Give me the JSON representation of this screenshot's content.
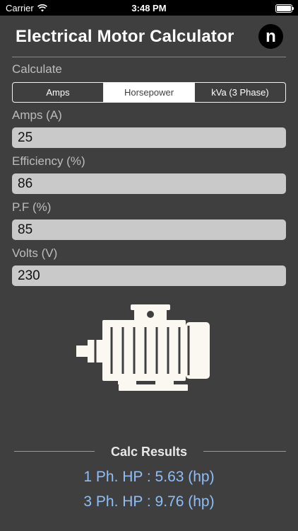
{
  "status_bar": {
    "carrier": "Carrier",
    "time": "3:48 PM"
  },
  "header": {
    "title": "Electrical Motor Calculator",
    "logo_letter": "n"
  },
  "calculate": {
    "label": "Calculate",
    "segments": [
      "Amps",
      "Horsepower",
      "kVa (3 Phase)"
    ],
    "selected": "Horsepower"
  },
  "fields": [
    {
      "label": "Amps (A)",
      "value": "25"
    },
    {
      "label": "Efficiency (%)",
      "value": "86"
    },
    {
      "label": "P.F (%)",
      "value": "85"
    },
    {
      "label": "Volts (V)",
      "value": "230"
    }
  ],
  "image": {
    "icon": "electric-motor-icon"
  },
  "results": {
    "title": "Calc Results",
    "single_phase": "1 Ph. HP : 5.63 (hp)",
    "three_phase": "3 Ph. HP : 9.76 (hp)"
  },
  "colors": {
    "background": "#3f3f3f",
    "result_text": "#8fbef7",
    "field_bg": "#c9c9c9"
  }
}
